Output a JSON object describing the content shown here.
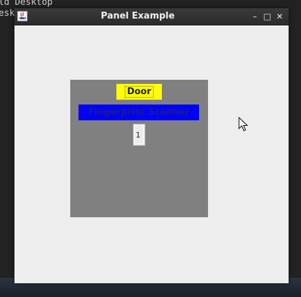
{
  "terminal": {
    "line1": "ld Desktop",
    "line2": "esk"
  },
  "window": {
    "title": "Panel Example",
    "buttons": {
      "minimize": "–",
      "maximize": "□",
      "close": "✕"
    }
  },
  "panel": {
    "door_label": "Door",
    "scanner_label": "Fingerprint Scanner",
    "field_value": "1"
  },
  "colors": {
    "panel_bg": "#808080",
    "door_bg": "#ffff00",
    "scanner_bg": "#0000ff",
    "content_bg": "#eeeeee"
  }
}
